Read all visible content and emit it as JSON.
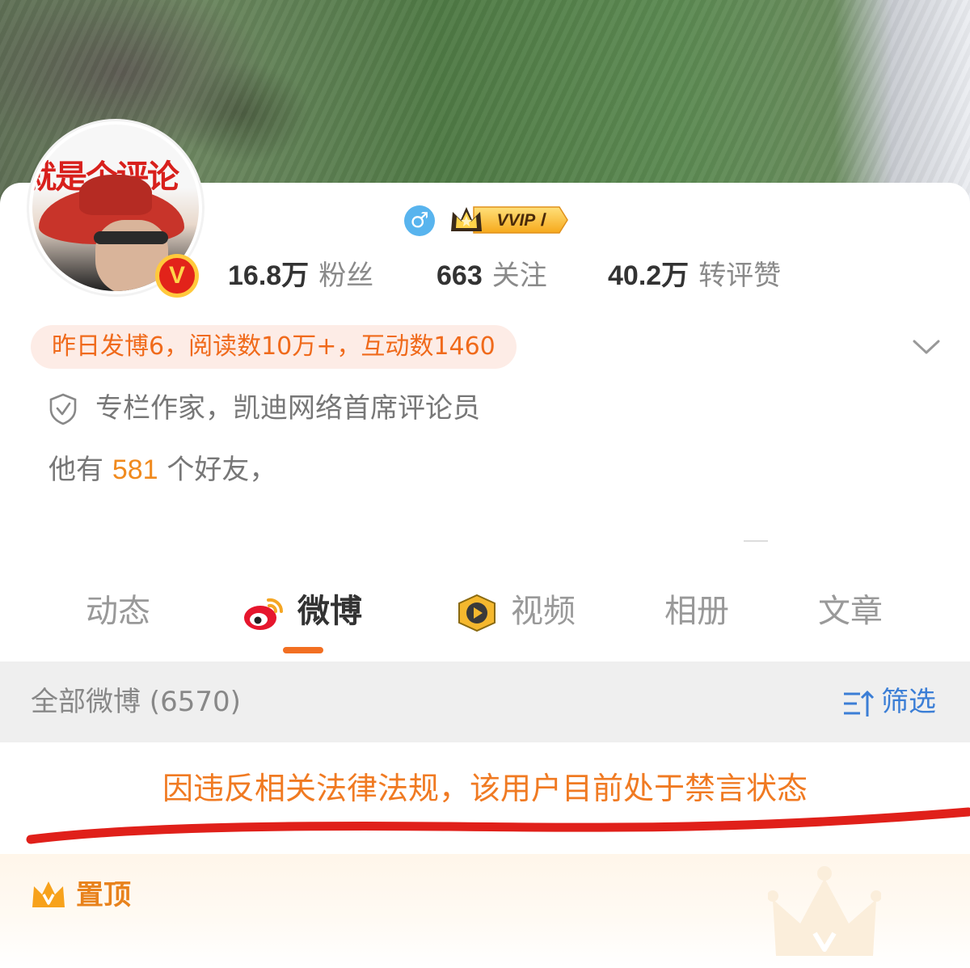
{
  "avatar": {
    "banner_text": "就是个评论"
  },
  "badges": {
    "verified_mark": "V",
    "vvip_label": "VVIP Ⅰ"
  },
  "stats": [
    {
      "value": "16.8万",
      "label": "粉丝"
    },
    {
      "value": "663",
      "label": "关注"
    },
    {
      "value": "40.2万",
      "label": "转评赞"
    }
  ],
  "daily_summary": "昨日发博6，阅读数10万+，互动数1460",
  "verification": "专栏作家，凯迪网络首席评论员",
  "friends": {
    "prefix": "他有",
    "count": "581",
    "suffix": "个好友，"
  },
  "tabs": [
    {
      "label": "动态"
    },
    {
      "label": "微博",
      "active": true
    },
    {
      "label": "视频"
    },
    {
      "label": "相册"
    },
    {
      "label": "文章"
    }
  ],
  "feed": {
    "all_weibo_label": "全部微博 (6570)",
    "filter_label": "筛选",
    "banned_notice": "因违反相关法律法规，该用户目前处于禁言状态",
    "pinned_label": "置顶"
  },
  "colors": {
    "accent_orange": "#f06a1b",
    "link_blue": "#3b7ed6",
    "annotation_red": "#e0201a",
    "pill_bg": "#fdece6"
  },
  "icons": [
    "male-gender-icon",
    "vvip-crown-icon",
    "chevron-down-icon",
    "shield-verified-icon",
    "weibo-logo-icon",
    "video-icon",
    "filter-icon",
    "crown-icon"
  ]
}
